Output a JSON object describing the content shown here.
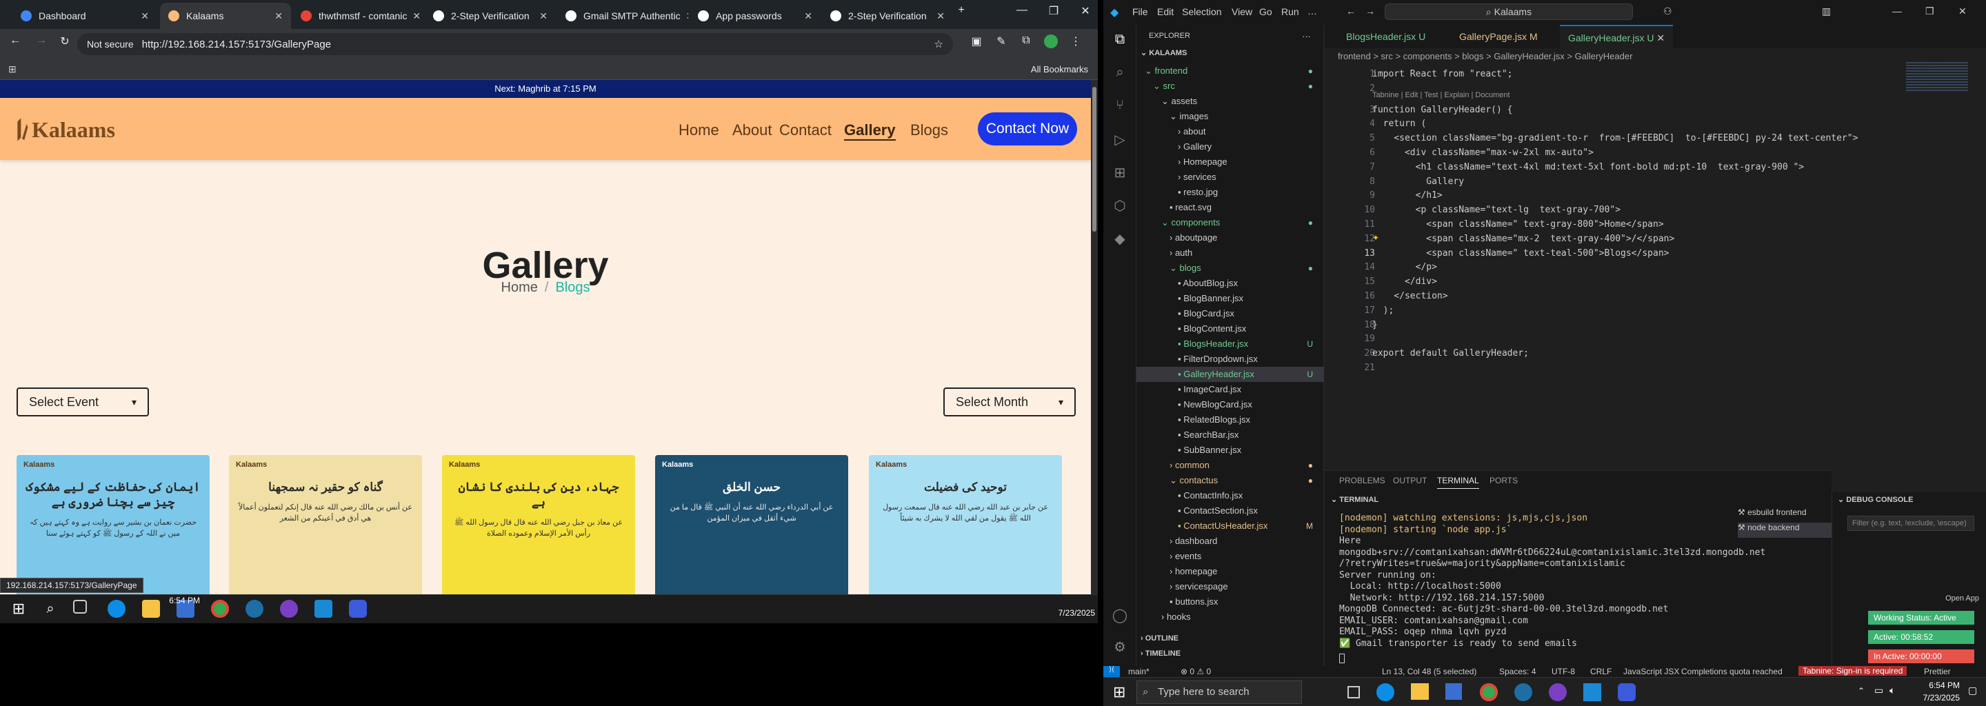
{
  "chrome": {
    "tabs": [
      "Dashboard",
      "Kalaams",
      "thwthmstf - comtanic",
      "2-Step Verification",
      "Gmail SMTP Authentic",
      "App passwords",
      "2-Step Verification"
    ],
    "url_security": "Not secure",
    "url": "http://192.168.214.157:5173/GalleryPage",
    "all_bookmarks": "All Bookmarks",
    "status_url": "192.168.214.157:5173/GalleryPage"
  },
  "site": {
    "top_strip": "Next: Maghrib at 7:15 PM",
    "logo_text": "Kalaams",
    "nav": [
      "Home",
      "About",
      "Contact",
      "Gallery",
      "Blogs"
    ],
    "contact_button": "Contact Now",
    "heading": "Gallery",
    "crumb_home": "Home",
    "crumb_sep": "/",
    "crumb_current": "Blogs",
    "select_event": "Select Event",
    "select_month": "Select Month",
    "cards": [
      {
        "logo": "Kalaams",
        "title": "ایمان کی حفاظت کے لیے مشکوک چیز سے بچنا ضروری ہے",
        "body": "حضرت نعمان بن بشیر سے روایت ہے وہ کہتے ہیں کہ میں نے اللہ کے رسول ﷺ کو کہتے ہوئے سنا",
        "color": "#7cc8ea"
      },
      {
        "logo": "Kalaams",
        "title": "گناہ کو حقیر نہ سمجھنا",
        "body": "عن أنس بن مالك رضي الله عنه قال إنكم لتعملون أعمالاً هي أدق في أعينكم من الشعر",
        "color": "#f0e0a6"
      },
      {
        "logo": "Kalaams",
        "title": "جہاد، دین کی بلندی کا نشان ہے",
        "body": "عن معاذ بن جبل رضي الله عنه قال قال رسول الله ﷺ رأس الأمر الإسلام وعموده الصلاة",
        "color": "#f5e03a"
      },
      {
        "logo": "Kalaams",
        "title": "حسن الخلق",
        "body": "عن أبي الدرداء رضي الله عنه أن النبي ﷺ قال ما من شيء أثقل في ميزان المؤمن",
        "color": "#1d4f6e"
      },
      {
        "logo": "Kalaams",
        "title": "توحید کی فضیلت",
        "body": "عن جابر بن عبد الله رضي الله عنه قال سمعت رسول الله ﷺ يقول من لقي الله لا يشرك به شيئاً",
        "color": "#a9dff2"
      }
    ]
  },
  "taskbar_left": {
    "time": "6:54 PM",
    "date": "7/23/2025"
  },
  "vscode": {
    "search": "Kalaams",
    "menu": [
      "File",
      "Edit",
      "Selection",
      "View",
      "Go",
      "Run"
    ],
    "explorer_title": "EXPLORER",
    "root": "KALAAMS",
    "tree": [
      {
        "label": "frontend",
        "depth": 1,
        "kind": "folder-open",
        "mark": "●",
        "color": "#73c991"
      },
      {
        "label": "src",
        "depth": 2,
        "kind": "folder-open",
        "mark": "●",
        "color": "#73c991"
      },
      {
        "label": "assets",
        "depth": 3,
        "kind": "folder-open",
        "mark": "",
        "color": "#cccccc"
      },
      {
        "label": "images",
        "depth": 4,
        "kind": "folder-open",
        "mark": "",
        "color": "#cccccc"
      },
      {
        "label": "about",
        "depth": 5,
        "kind": "folder",
        "mark": "",
        "color": "#cccccc"
      },
      {
        "label": "Gallery",
        "depth": 5,
        "kind": "folder",
        "mark": "",
        "color": "#cccccc"
      },
      {
        "label": "Homepage",
        "depth": 5,
        "kind": "folder",
        "mark": "",
        "color": "#cccccc"
      },
      {
        "label": "services",
        "depth": 5,
        "kind": "folder",
        "mark": "",
        "color": "#cccccc"
      },
      {
        "label": "resto.jpg",
        "depth": 5,
        "kind": "file",
        "mark": "",
        "color": "#cccccc"
      },
      {
        "label": "react.svg",
        "depth": 4,
        "kind": "file",
        "mark": "",
        "color": "#cccccc"
      },
      {
        "label": "components",
        "depth": 3,
        "kind": "folder-open",
        "mark": "●",
        "color": "#73c991"
      },
      {
        "label": "aboutpage",
        "depth": 4,
        "kind": "folder",
        "mark": "",
        "color": "#cccccc"
      },
      {
        "label": "auth",
        "depth": 4,
        "kind": "folder",
        "mark": "",
        "color": "#cccccc"
      },
      {
        "label": "blogs",
        "depth": 4,
        "kind": "folder-open",
        "mark": "●",
        "color": "#73c991"
      },
      {
        "label": "AboutBlog.jsx",
        "depth": 5,
        "kind": "file",
        "mark": "",
        "color": "#cccccc"
      },
      {
        "label": "BlogBanner.jsx",
        "depth": 5,
        "kind": "file",
        "mark": "",
        "color": "#cccccc"
      },
      {
        "label": "BlogCard.jsx",
        "depth": 5,
        "kind": "file",
        "mark": "",
        "color": "#cccccc"
      },
      {
        "label": "BlogContent.jsx",
        "depth": 5,
        "kind": "file",
        "mark": "",
        "color": "#cccccc"
      },
      {
        "label": "BlogsHeader.jsx",
        "depth": 5,
        "kind": "file",
        "mark": "U",
        "color": "#73c991"
      },
      {
        "label": "FilterDropdown.jsx",
        "depth": 5,
        "kind": "file",
        "mark": "",
        "color": "#cccccc"
      },
      {
        "label": "GalleryHeader.jsx",
        "depth": 5,
        "kind": "file",
        "mark": "U",
        "color": "#73c991"
      },
      {
        "label": "ImageCard.jsx",
        "depth": 5,
        "kind": "file",
        "mark": "",
        "color": "#cccccc"
      },
      {
        "label": "NewBlogCard.jsx",
        "depth": 5,
        "kind": "file",
        "mark": "",
        "color": "#cccccc"
      },
      {
        "label": "RelatedBlogs.jsx",
        "depth": 5,
        "kind": "file",
        "mark": "",
        "color": "#cccccc"
      },
      {
        "label": "SearchBar.jsx",
        "depth": 5,
        "kind": "file",
        "mark": "",
        "color": "#cccccc"
      },
      {
        "label": "SubBanner.jsx",
        "depth": 5,
        "kind": "file",
        "mark": "",
        "color": "#cccccc"
      },
      {
        "label": "common",
        "depth": 4,
        "kind": "folder",
        "mark": "●",
        "color": "#e2c08d"
      },
      {
        "label": "contactus",
        "depth": 4,
        "kind": "folder-open",
        "mark": "●",
        "color": "#e2c08d"
      },
      {
        "label": "ContactInfo.jsx",
        "depth": 5,
        "kind": "file",
        "mark": "",
        "color": "#cccccc"
      },
      {
        "label": "ContactSection.jsx",
        "depth": 5,
        "kind": "file",
        "mark": "",
        "color": "#cccccc"
      },
      {
        "label": "ContactUsHeader.jsx",
        "depth": 5,
        "kind": "file",
        "mark": "M",
        "color": "#e2c08d"
      },
      {
        "label": "dashboard",
        "depth": 4,
        "kind": "folder",
        "mark": "",
        "color": "#cccccc"
      },
      {
        "label": "events",
        "depth": 4,
        "kind": "folder",
        "mark": "",
        "color": "#cccccc"
      },
      {
        "label": "homepage",
        "depth": 4,
        "kind": "folder",
        "mark": "",
        "color": "#cccccc"
      },
      {
        "label": "servicespage",
        "depth": 4,
        "kind": "folder",
        "mark": "",
        "color": "#cccccc"
      },
      {
        "label": "buttons.jsx",
        "depth": 4,
        "kind": "file",
        "mark": "",
        "color": "#cccccc"
      },
      {
        "label": "hooks",
        "depth": 3,
        "kind": "folder",
        "mark": "",
        "color": "#cccccc"
      }
    ],
    "outline": "OUTLINE",
    "timeline": "TIMELINE",
    "tabs": [
      {
        "label": "BlogsHeader.jsx",
        "mark": "U"
      },
      {
        "label": "GalleryPage.jsx",
        "mark": "M"
      },
      {
        "label": "GalleryHeader.jsx",
        "mark": "U"
      }
    ],
    "breadcrumb": "frontend > src > components > blogs > GalleryHeader.jsx > GalleryHeader",
    "codelens": "Tabnine | Edit | Test | Explain | Document",
    "code": [
      "import React from \"react\";",
      "",
      "function GalleryHeader() {",
      "  return (",
      "    <section className=\"bg-gradient-to-r  from-[#FEEBDC]  to-[#FEEBDC] py-24 text-center\">",
      "      <div className=\"max-w-2xl mx-auto\">",
      "        <h1 className=\"text-4xl md:text-5xl font-bold md:pt-10  text-gray-900 \">",
      "          Gallery",
      "        </h1>",
      "        <p className=\"text-lg  text-gray-700\">",
      "          <span className=\" text-gray-800\">Home</span>",
      "          <span className=\"mx-2  text-gray-400\">/</span>",
      "          <span className=\" text-teal-500\">Blogs</span>",
      "        </p>",
      "      </div>",
      "    </section>",
      "  );",
      "}",
      "",
      "export default GalleryHeader;",
      ""
    ],
    "panel_tabs": [
      "PROBLEMS",
      "OUTPUT",
      "TERMINAL",
      "PORTS"
    ],
    "terminal_title": "TERMINAL",
    "terminal": [
      "[nodemon] watching extensions: js,mjs,cjs,json",
      "[nodemon] starting `node app.js`",
      "Here",
      "mongodb+srv://comtanixahsan:dWVMr6tD66224uL@comtanixislamic.3tel3zd.mongodb.net",
      "/?retryWrites=true&w=majority&appName=comtanixislamic",
      "Server running on:",
      "  Local: http://localhost:5000",
      "  Network: http://192.168.214.157:5000",
      "MongoDB Connected: ac-6utjz9t-shard-00-00.3tel3zd.mongodb.net",
      "EMAIL_USER: comtanixahsan@gmail.com",
      "EMAIL_PASS: oqep nhma lqvh pyzd",
      "✅ Gmail transporter is ready to send emails"
    ],
    "terminals": [
      "esbuild frontend",
      "node backend"
    ],
    "debug_title": "DEBUG CONSOLE",
    "debug_filter": "Filter (e.g. text, !exclude, \\escape)",
    "statusbar": {
      "branch": "main*",
      "errors": "⊗ 0 ⚠ 0",
      "position": "Ln 13, Col 48 (5 selected)",
      "spaces": "Spaces: 4",
      "encoding": "UTF-8",
      "eol": "CRLF",
      "lang": "JavaScript JSX",
      "completions": "Completions quota reached",
      "tabnine": "Tabnine: Sign-in is required",
      "prettier": "Prettier"
    },
    "open_app": "Open App",
    "working_status": "Working Status: Active",
    "active_time": "Active: 00:58:52",
    "inactive_time": "In Active: 00:00:00"
  },
  "taskbar_right": {
    "search": "Type here to search",
    "time": "6:54 PM",
    "date": "7/23/2025"
  }
}
